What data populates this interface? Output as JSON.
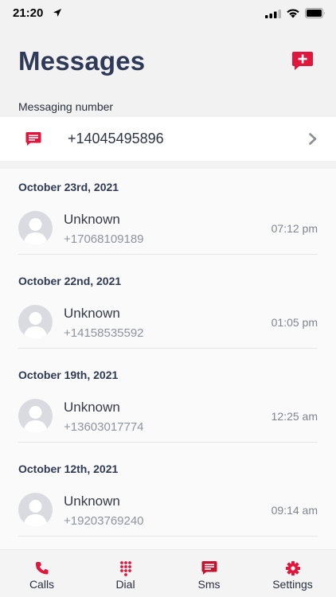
{
  "status_bar": {
    "time": "21:20"
  },
  "header": {
    "title": "Messages",
    "new_message_icon": "add-message-icon"
  },
  "messaging_number": {
    "label": "Messaging number",
    "number": "+14045495896",
    "icon": "sms-icon"
  },
  "conversations": [
    {
      "date": "October 23rd, 2021",
      "name": "Unknown",
      "phone": "+17068109189",
      "time": "07:12 pm"
    },
    {
      "date": "October 22nd, 2021",
      "name": "Unknown",
      "phone": "+14158535592",
      "time": "01:05 pm"
    },
    {
      "date": "October 19th, 2021",
      "name": "Unknown",
      "phone": "+13603017774",
      "time": "12:25 am"
    },
    {
      "date": "October 12th, 2021",
      "name": "Unknown",
      "phone": "+19203769240",
      "time": "09:14 am"
    }
  ],
  "tabs": [
    {
      "label": "Calls",
      "icon": "phone-icon"
    },
    {
      "label": "Dial",
      "icon": "dialpad-icon"
    },
    {
      "label": "Sms",
      "icon": "sms-icon",
      "active": true
    },
    {
      "label": "Settings",
      "icon": "gear-icon"
    }
  ],
  "colors": {
    "accent": "#e0163d",
    "title": "#2f3a59",
    "background": "#f2f2f3"
  }
}
